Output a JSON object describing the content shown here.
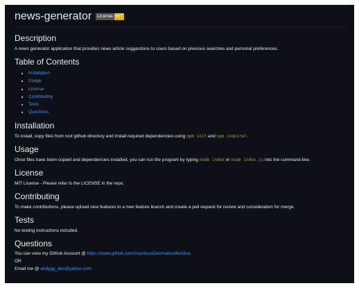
{
  "title": "news-generator",
  "badge": {
    "label": "License",
    "value": "MIT"
  },
  "description": {
    "heading": "Description",
    "text": "A news generator application that provides news article suggestions to users based on previous searches and personal preferences."
  },
  "toc": {
    "heading": "Table of Contents",
    "items": [
      "Installation",
      "Usage",
      "License",
      "Contributing",
      "Tests",
      "Questions"
    ]
  },
  "installation": {
    "heading": "Installation",
    "text_before": "To install, copy files from root github directory and install required dependencies using ",
    "code1": "npm init",
    "text_mid": " and ",
    "code2": "npm inquirer",
    "text_after": "."
  },
  "usage": {
    "heading": "Usage",
    "text_before": "Once files have been copied and dependencies installed, you can run the program by typing ",
    "code1": "node index",
    "text_mid": " or ",
    "code2": "node index.js",
    "text_after": " into the command-line."
  },
  "license": {
    "heading": "License",
    "text": "MIT License - Please refer to the LICENSE in the repo."
  },
  "contributing": {
    "heading": "Contributing",
    "text": "To make contributions, please upload new features to a new feature branch and create a pull request for review and consideration for merge."
  },
  "tests": {
    "heading": "Tests",
    "text": "No testing instructions included."
  },
  "questions": {
    "heading": "Questions",
    "github_prefix": "You can view my Github Account @ ",
    "github_link": "https://www.github.com/maximusDecimalusMeridius",
    "or": "OR",
    "email_prefix": "Email me @ ",
    "email_link": "andygg_dev@yahoo.com"
  },
  "colors": {
    "background": "#0d1117",
    "text": "#e6edf3",
    "link": "#4493f8",
    "code": "#d29922",
    "badge_label_bg": "#555555",
    "badge_value_bg": "#dfb317"
  }
}
